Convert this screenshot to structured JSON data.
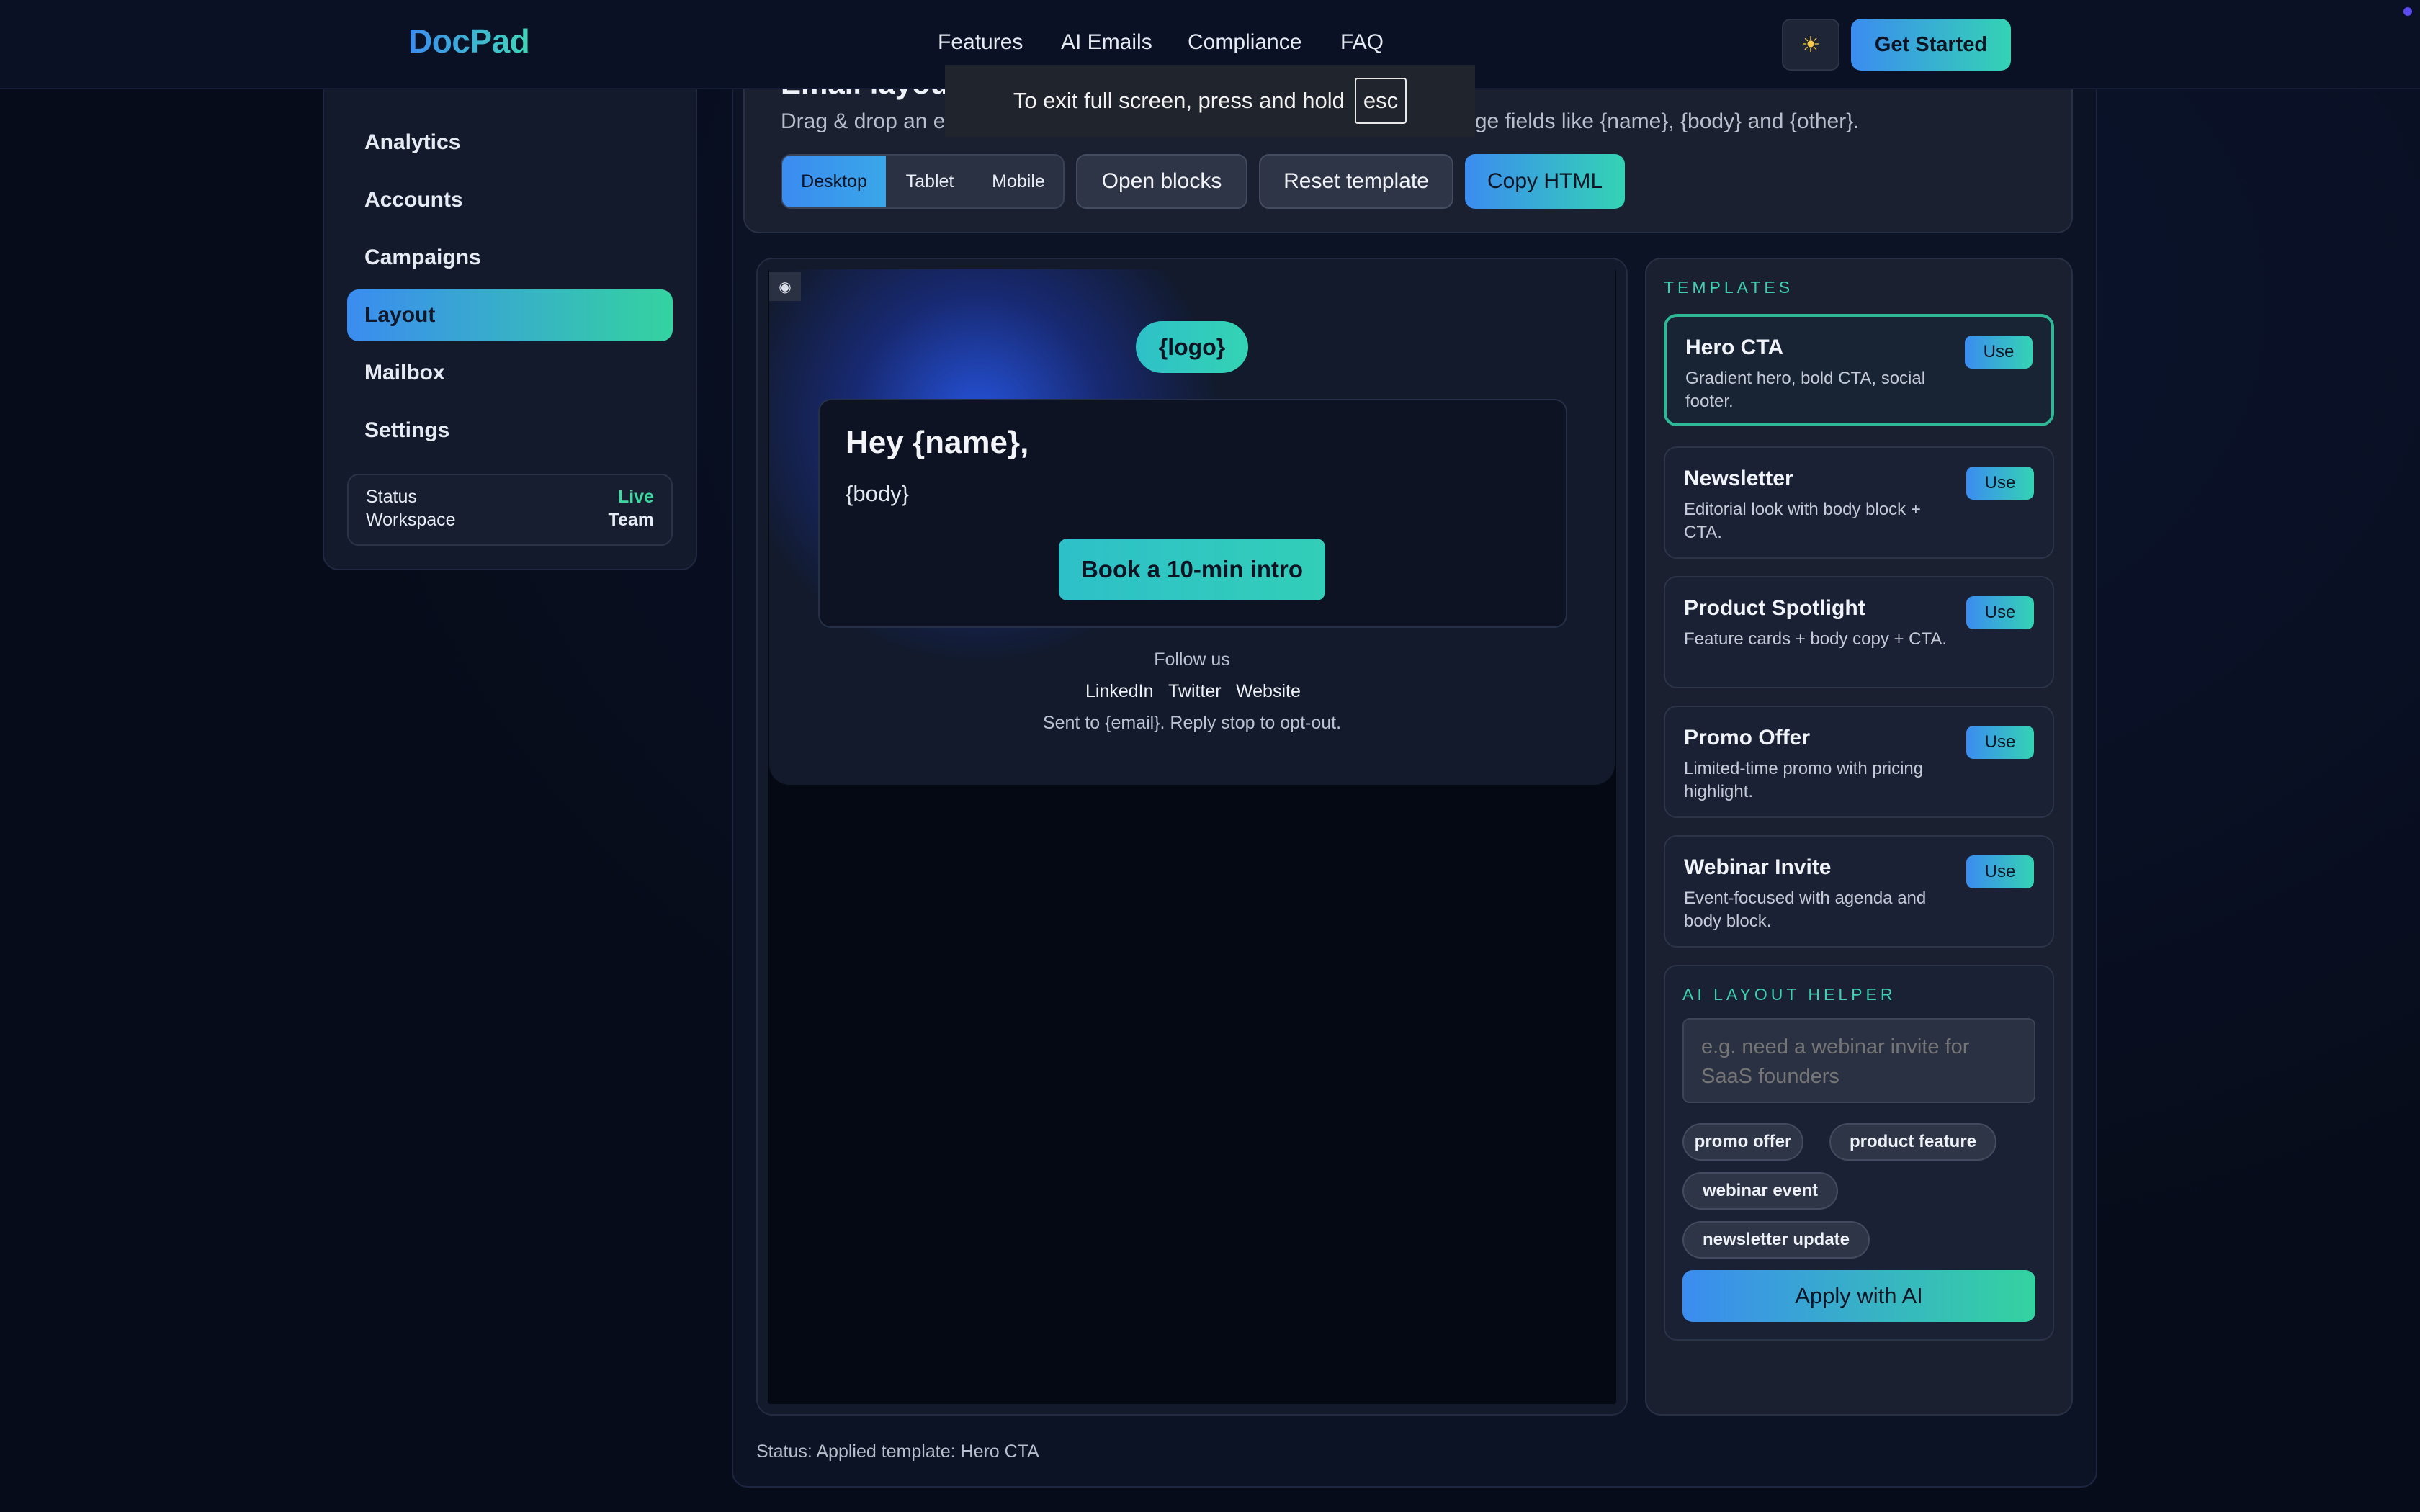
{
  "nav": {
    "brand": "DocPad",
    "links": [
      "Features",
      "AI Emails",
      "Compliance",
      "FAQ"
    ],
    "theme_icon": "sun-icon",
    "theme_glyph": "☀",
    "cta": "Get Started"
  },
  "fullscreen_notice": {
    "text": "To exit full screen, press and hold",
    "key": "esc"
  },
  "sidebar": {
    "items": [
      {
        "label": "Analytics"
      },
      {
        "label": "Accounts"
      },
      {
        "label": "Campaigns"
      },
      {
        "label": "Layout",
        "active": true
      },
      {
        "label": "Mailbox"
      },
      {
        "label": "Settings"
      }
    ],
    "status": {
      "status_label": "Status",
      "status_value": "Live",
      "workspace_label": "Workspace",
      "workspace_value": "Team"
    }
  },
  "header": {
    "title": "Email layout",
    "subtitle": "Drag & drop an email layout to design, preview and personalize with merge fields like {name}, {body} and {other}.",
    "devices": [
      "Desktop",
      "Tablet",
      "Mobile"
    ],
    "active_device": "Desktop",
    "open_blocks": "Open blocks",
    "reset_template": "Reset template",
    "copy_html": "Copy HTML"
  },
  "preview": {
    "toggle_icon": "eye-off-icon",
    "toggle_glyph": "◉",
    "logo": "{logo}",
    "greeting": "Hey {name},",
    "body": "{body}",
    "cta": "Book a 10-min intro",
    "follow_label": "Follow us",
    "social": [
      "LinkedIn",
      "Twitter",
      "Website"
    ],
    "footer": "Sent to {email}. Reply stop to opt-out."
  },
  "templates": {
    "section_title": "TEMPLATES",
    "use_label": "Use",
    "items": [
      {
        "name": "Hero CTA",
        "desc": "Gradient hero, bold CTA, social footer.",
        "selected": true
      },
      {
        "name": "Newsletter",
        "desc": "Editorial look with body block + CTA."
      },
      {
        "name": "Product Spotlight",
        "desc": "Feature cards + body copy + CTA."
      },
      {
        "name": "Promo Offer",
        "desc": "Limited-time promo with pricing highlight."
      },
      {
        "name": "Webinar Invite",
        "desc": "Event-focused with agenda and body block."
      }
    ]
  },
  "ai_helper": {
    "section_title": "AI LAYOUT HELPER",
    "placeholder": "e.g. need a webinar invite for SaaS founders",
    "chips": [
      "promo offer",
      "product feature",
      "webinar event",
      "newsletter update"
    ],
    "apply": "Apply with AI"
  },
  "status_line": "Status: Applied template: Hero CTA",
  "colors": {
    "background": "#070c1a",
    "accent_blue": "#3b8cf0",
    "accent_teal": "#34d3b4",
    "live_green": "#3fd6a0"
  }
}
